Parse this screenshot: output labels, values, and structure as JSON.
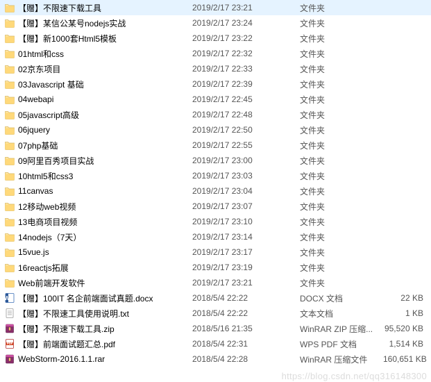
{
  "files": [
    {
      "icon": "folder",
      "name": "【赠】不限速下载工具",
      "date": "2019/2/17 23:21",
      "type": "文件夹",
      "size": ""
    },
    {
      "icon": "folder",
      "name": "【赠】某信公某号nodejs实战",
      "date": "2019/2/17 23:24",
      "type": "文件夹",
      "size": ""
    },
    {
      "icon": "folder",
      "name": "【赠】新1000套Html5模板",
      "date": "2019/2/17 23:22",
      "type": "文件夹",
      "size": ""
    },
    {
      "icon": "folder",
      "name": "01html和css",
      "date": "2019/2/17 22:32",
      "type": "文件夹",
      "size": ""
    },
    {
      "icon": "folder",
      "name": "02京东项目",
      "date": "2019/2/17 22:33",
      "type": "文件夹",
      "size": ""
    },
    {
      "icon": "folder",
      "name": "03Javascript 基础",
      "date": "2019/2/17 22:39",
      "type": "文件夹",
      "size": ""
    },
    {
      "icon": "folder",
      "name": "04webapi",
      "date": "2019/2/17 22:45",
      "type": "文件夹",
      "size": ""
    },
    {
      "icon": "folder",
      "name": "05javascript高级",
      "date": "2019/2/17 22:48",
      "type": "文件夹",
      "size": ""
    },
    {
      "icon": "folder",
      "name": "06jquery",
      "date": "2019/2/17 22:50",
      "type": "文件夹",
      "size": ""
    },
    {
      "icon": "folder",
      "name": "07php基础",
      "date": "2019/2/17 22:55",
      "type": "文件夹",
      "size": ""
    },
    {
      "icon": "folder",
      "name": "09阿里百秀项目实战",
      "date": "2019/2/17 23:00",
      "type": "文件夹",
      "size": ""
    },
    {
      "icon": "folder",
      "name": "10html5和css3",
      "date": "2019/2/17 23:03",
      "type": "文件夹",
      "size": ""
    },
    {
      "icon": "folder",
      "name": "11canvas",
      "date": "2019/2/17 23:04",
      "type": "文件夹",
      "size": ""
    },
    {
      "icon": "folder",
      "name": "12移动web视频",
      "date": "2019/2/17 23:07",
      "type": "文件夹",
      "size": ""
    },
    {
      "icon": "folder",
      "name": "13电商项目视频",
      "date": "2019/2/17 23:10",
      "type": "文件夹",
      "size": ""
    },
    {
      "icon": "folder",
      "name": "14nodejs（7天）",
      "date": "2019/2/17 23:14",
      "type": "文件夹",
      "size": ""
    },
    {
      "icon": "folder",
      "name": "15vue.js",
      "date": "2019/2/17 23:17",
      "type": "文件夹",
      "size": ""
    },
    {
      "icon": "folder",
      "name": "16reactjs拓展",
      "date": "2019/2/17 23:19",
      "type": "文件夹",
      "size": ""
    },
    {
      "icon": "folder",
      "name": "Web前端开发软件",
      "date": "2019/2/17 23:21",
      "type": "文件夹",
      "size": ""
    },
    {
      "icon": "docx",
      "name": "【赠】100IT 名企前端面试真题.docx",
      "date": "2018/5/4 22:22",
      "type": "DOCX 文档",
      "size": "22 KB"
    },
    {
      "icon": "txt",
      "name": "【赠】不限速工具使用说明.txt",
      "date": "2018/5/4 22:22",
      "type": "文本文档",
      "size": "1 KB"
    },
    {
      "icon": "rar",
      "name": "【赠】不限速下载工具.zip",
      "date": "2018/5/16 21:35",
      "type": "WinRAR ZIP 压缩...",
      "size": "95,520 KB"
    },
    {
      "icon": "pdf",
      "name": "【赠】前端面试题汇总.pdf",
      "date": "2018/5/4 22:31",
      "type": "WPS PDF 文档",
      "size": "1,514 KB"
    },
    {
      "icon": "rar",
      "name": "WebStorm-2016.1.1.rar",
      "date": "2018/5/4 22:28",
      "type": "WinRAR 压缩文件",
      "size": "160,651 KB"
    }
  ],
  "watermark": "https://blog.csdn.net/qq316148300"
}
